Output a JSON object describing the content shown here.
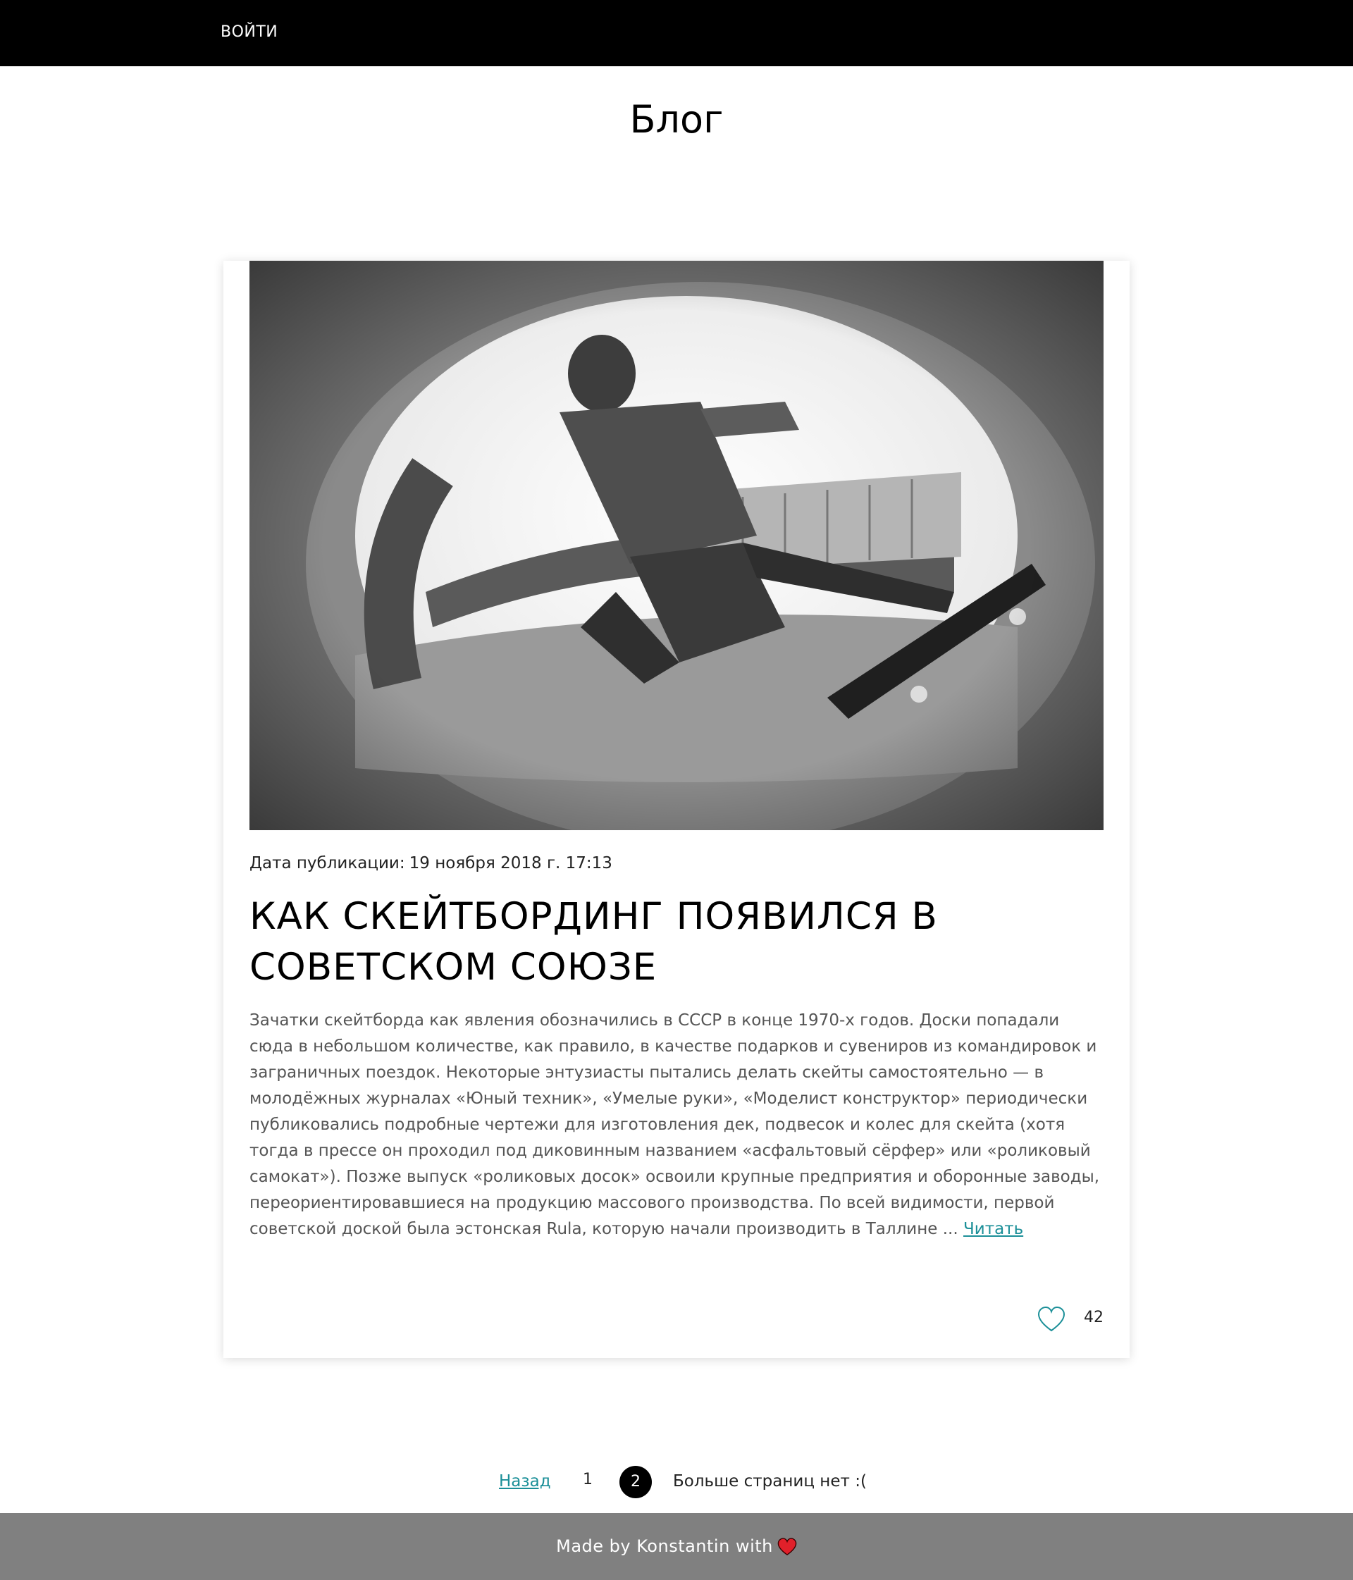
{
  "header": {
    "login_label": "ВОЙТИ"
  },
  "page": {
    "title": "Блог"
  },
  "post": {
    "date_label": "Дата публикации:",
    "date_value": "19 ноября 2018 г. 17:13",
    "title": "КАК СКЕЙТБОРДИНГ ПОЯВИЛСЯ В СОВЕТСКОМ СОЮЗЕ",
    "excerpt": "Зачатки скейтборда как явления обозначились в СССР в конце 1970-х годов. Доски попадали сюда в небольшом количестве, как правило, в качестве подарков и сувениров из командировок и заграничных поездок. Некоторые энтузиасты пытались делать скейты самостоятельно — в молодёжных журналах «Юный техник», «Умелые руки», «Моделист конструктор» периодически публиковались подробные чертежи для изготовления дек, подвесок и колес для скейта (хотя тогда в прессе он проходил под диковинным названием «асфальтовый сёрфер» или «роликовый самокат»). Позже выпуск «роликовых досок» освоили крупные предприятия и оборонные заводы, переориентировавшиеся на продукцию массового производства. По всей видимости, первой советской доской была эстонская Rula, которую начали производить в Таллине ...",
    "read_more_label": "Читать",
    "likes": "42",
    "like_icon": "heart-outline-icon",
    "accent_color": "#1b8f98"
  },
  "pagination": {
    "prev_label": "Назад",
    "pages": [
      "1",
      "2"
    ],
    "current_page": "2",
    "end_message": "Больше страниц нет :("
  },
  "footer": {
    "text": "Made by Konstantin with",
    "icon": "heart-icon",
    "icon_color": "#e0202a"
  }
}
